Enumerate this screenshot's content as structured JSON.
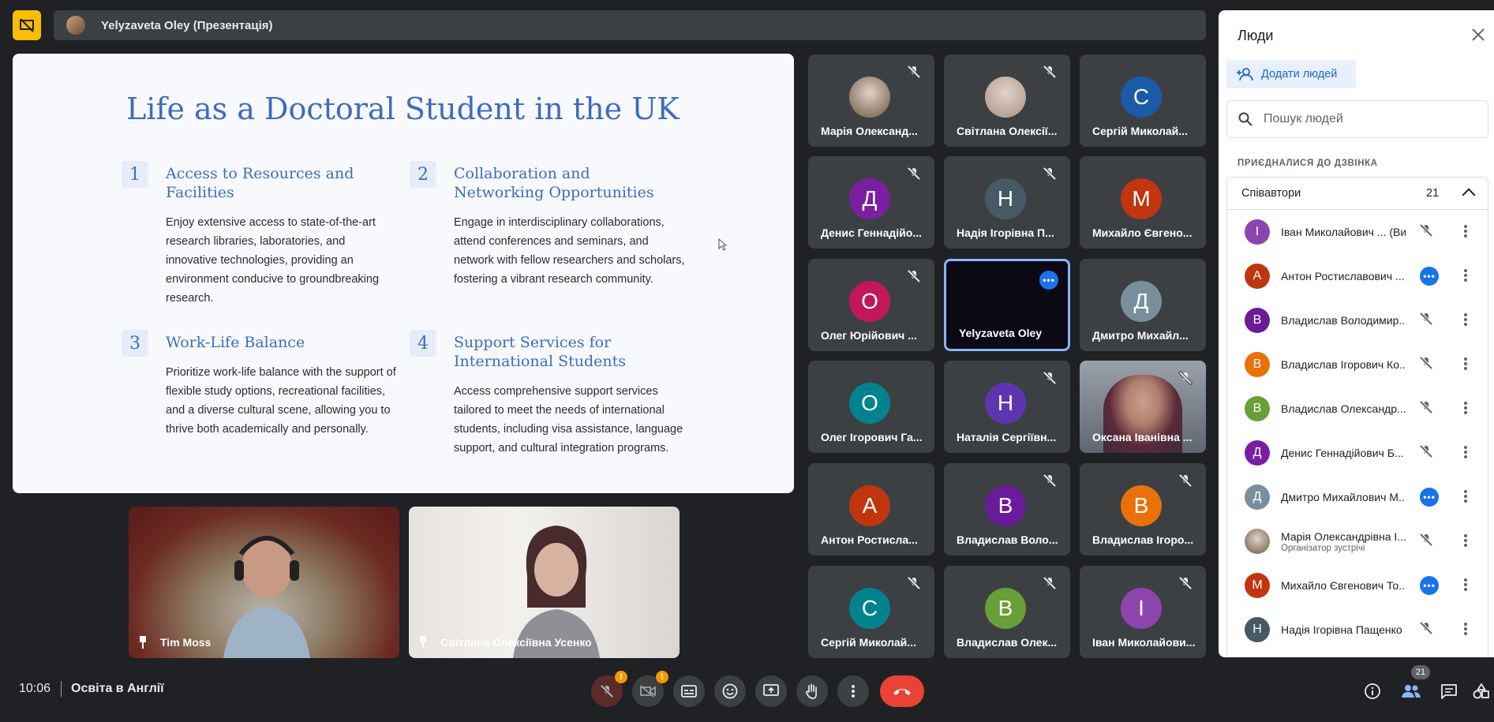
{
  "topbar": {
    "presenter_label": "Yelyzaveta Oley (Презентація)"
  },
  "slide": {
    "title": "Life as a Doctoral Student in the UK",
    "sections": [
      {
        "num": "1",
        "title": "Access to Resources and Facilities",
        "body": "Enjoy extensive access to state-of-the-art research libraries, laboratories, and innovative technologies, providing an environment conducive to groundbreaking research."
      },
      {
        "num": "2",
        "title": "Collaboration and Networking Opportunities",
        "body": "Engage in interdisciplinary collaborations, attend conferences and seminars, and network with fellow researchers and scholars, fostering a vibrant research community."
      },
      {
        "num": "3",
        "title": "Work-Life Balance",
        "body": "Prioritize work-life balance with the support of flexible study options, recreational facilities, and a diverse cultural scene, allowing you to thrive both academically and personally."
      },
      {
        "num": "4",
        "title": "Support Services for International Students",
        "body": "Access comprehensive support services tailored to meet the needs of international students, including visa assistance, language support, and cultural integration programs."
      }
    ]
  },
  "pinned": [
    {
      "name": "Tim Moss"
    },
    {
      "name": "Світлана Олексіївна Усенко"
    }
  ],
  "tiles": [
    {
      "name": "Марія Олександ...",
      "initial": "",
      "color": "#8d7b6a",
      "photo": true,
      "muted": true
    },
    {
      "name": "Світлана Олексії...",
      "initial": "",
      "color": "#b8a59a",
      "photo": true,
      "muted": true
    },
    {
      "name": "Сергій Миколай...",
      "initial": "С",
      "color": "#1a5aa8",
      "muted": false
    },
    {
      "name": "Денис Геннадійо...",
      "initial": "Д",
      "color": "#7b1fa2",
      "muted": true
    },
    {
      "name": "Надія Ігорівна П...",
      "initial": "Н",
      "color": "#455a64",
      "muted": true
    },
    {
      "name": "Михайло Євгено...",
      "initial": "М",
      "color": "#c1350f",
      "muted": false
    },
    {
      "name": "Олег Юрійович ...",
      "initial": "О",
      "color": "#c2185b",
      "muted": true
    },
    {
      "name": "Yelyzaveta Oley",
      "initial": "",
      "color": "#0b0a14",
      "active": true,
      "muted": false
    },
    {
      "name": "Дмитро Михайл...",
      "initial": "Д",
      "color": "#78909c",
      "muted": false
    },
    {
      "name": "Олег Ігорович Га...",
      "initial": "О",
      "color": "#00838f",
      "muted": false
    },
    {
      "name": "Наталія Сергіївн...",
      "initial": "Н",
      "color": "#5e35b1",
      "muted": true
    },
    {
      "name": "Оксана Іванівна ...",
      "initial": "",
      "color": "#6b7380",
      "photo": true,
      "muted": true
    },
    {
      "name": "Антон Ростисла...",
      "initial": "А",
      "color": "#bf360c",
      "muted": false
    },
    {
      "name": "Владислав Воло...",
      "initial": "В",
      "color": "#6a1b9a",
      "muted": true
    },
    {
      "name": "Владислав Ігоро...",
      "initial": "В",
      "color": "#e8710a",
      "muted": true
    },
    {
      "name": "Сергій Миколай...",
      "initial": "С",
      "color": "#00838f",
      "muted": true
    },
    {
      "name": "Владислав Олек...",
      "initial": "В",
      "color": "#689f38",
      "muted": true
    },
    {
      "name": "Іван Миколайови...",
      "initial": "І",
      "color": "#8e44ad",
      "muted": true
    }
  ],
  "panel": {
    "title": "Люди",
    "add_people": "Додати людей",
    "search_placeholder": "Пошук людей",
    "joined_label": "ПРИЄДНАЛИСЯ ДО ДЗВІНКА",
    "cohosts_label": "Співавтори",
    "cohosts_count": "21",
    "people": [
      {
        "name": "Іван Миколайович ... (Ви)",
        "initial": "І",
        "color": "#8e44ad",
        "state": "muted"
      },
      {
        "name": "Антон Ростиславович ...",
        "initial": "А",
        "color": "#bf360c",
        "state": "dots"
      },
      {
        "name": "Владислав Володимир...",
        "initial": "В",
        "color": "#6a1b9a",
        "state": "muted"
      },
      {
        "name": "Владислав Ігорович Ко...",
        "initial": "В",
        "color": "#e8710a",
        "state": "muted"
      },
      {
        "name": "Владислав Олександр...",
        "initial": "В",
        "color": "#689f38",
        "state": "muted"
      },
      {
        "name": "Денис Геннадійович Б...",
        "initial": "Д",
        "color": "#7b1fa2",
        "state": "muted"
      },
      {
        "name": "Дмитро Михайлович М...",
        "initial": "Д",
        "color": "#78909c",
        "state": "dots"
      },
      {
        "name": "Марія Олександрівна І...",
        "initial": "",
        "color": "#8d7b6a",
        "photo": true,
        "role": "Організатор зустрічі",
        "state": "muted"
      },
      {
        "name": "Михайло Євгенович То...",
        "initial": "М",
        "color": "#c1350f",
        "state": "dots"
      },
      {
        "name": "Надія Ігорівна Пащенко",
        "initial": "Н",
        "color": "#455a64",
        "state": "muted"
      }
    ]
  },
  "bottombar": {
    "time": "10:06",
    "meeting_name": "Освіта в Англії",
    "people_count": "21"
  }
}
